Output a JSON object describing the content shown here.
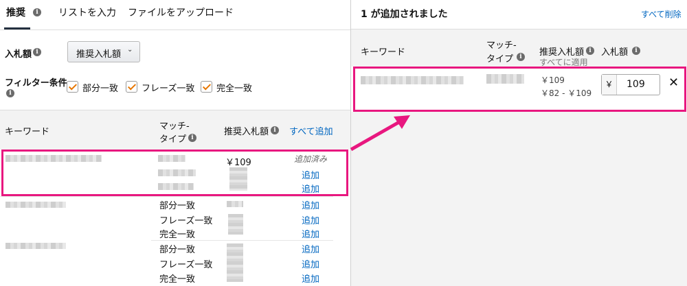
{
  "tabs": [
    {
      "label": "推奨"
    },
    {
      "label": "リストを入力"
    },
    {
      "label": "ファイルをアップロード"
    }
  ],
  "bid": {
    "label": "入札額",
    "dropdown_value": "推奨入札額"
  },
  "filter": {
    "label": "フィルター条件",
    "options": [
      {
        "label": "部分一致",
        "checked": true
      },
      {
        "label": "フレーズ一致",
        "checked": true
      },
      {
        "label": "完全一致",
        "checked": true
      }
    ]
  },
  "left_table": {
    "col_keyword": "キーワード",
    "col_match_line1": "マッチ-",
    "col_match_line2": "タイプ",
    "col_suggested": "推奨入札額",
    "add_all": "すべて追加",
    "row1_bid": "￥109",
    "row1_status": "追加済み",
    "add_label": "追加",
    "match_types": [
      "部分一致",
      "フレーズ一致",
      "完全一致"
    ]
  },
  "right_panel": {
    "title": "1 が追加されました",
    "remove_all": "すべて削除",
    "col_keyword": "キーワード",
    "col_match_line1": "マッチ-",
    "col_match_line2": "タイプ",
    "col_suggested": "推奨入札額",
    "apply_all": "すべてに適用",
    "col_bid": "入札額",
    "row_suggested": "￥109",
    "row_range": "￥82 - ￥109",
    "currency": "￥",
    "bid_value": "109",
    "remove_icon": "close-icon"
  },
  "colors": {
    "highlight": "#e8177f",
    "link": "#0066c0",
    "check": "#e77600",
    "tab_underline": "#232f3e"
  }
}
